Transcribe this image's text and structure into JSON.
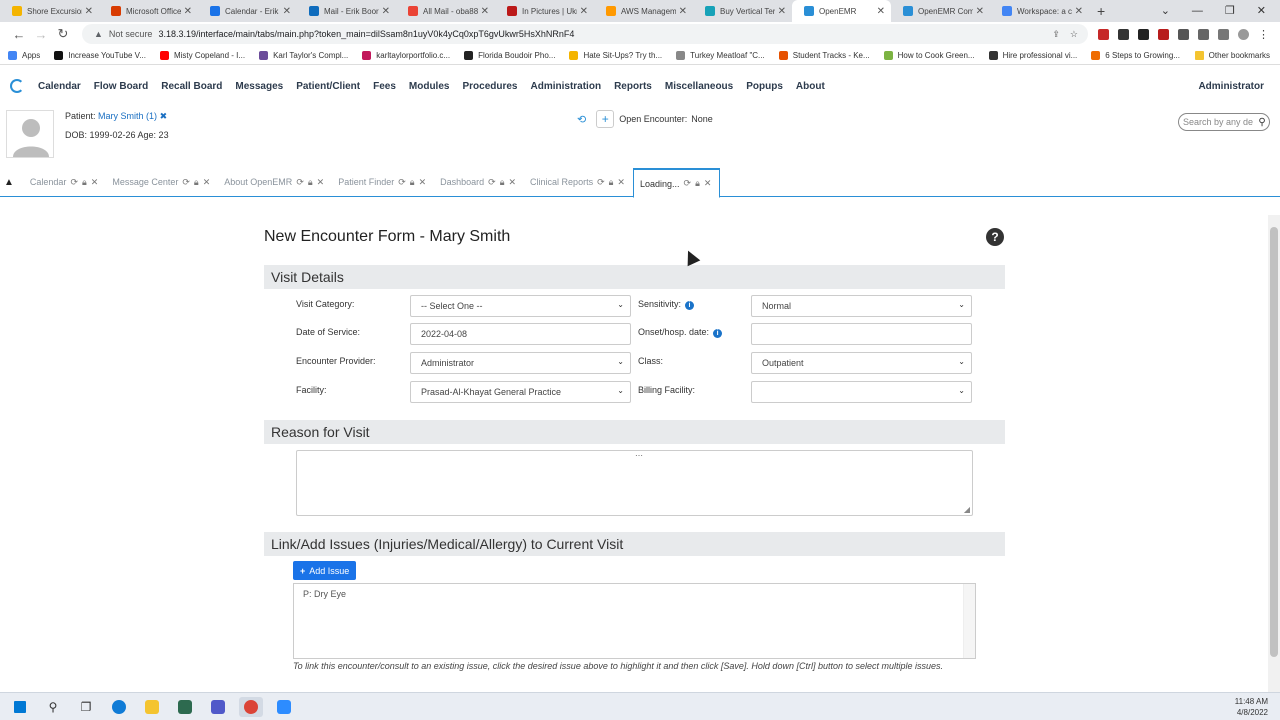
{
  "browser": {
    "tabs": [
      {
        "title": "Shore Excursion",
        "color": "#f4b400"
      },
      {
        "title": "Microsoft Office",
        "color": "#d83b01"
      },
      {
        "title": "Calendar - Erik",
        "color": "#1a73e8"
      },
      {
        "title": "Mail - Erik Boor",
        "color": "#0f6cbd"
      },
      {
        "title": "All Mail - oba88",
        "color": "#ea4335"
      },
      {
        "title": "In Pictures | Ukr",
        "color": "#bb1919"
      },
      {
        "title": "AWS Manageme",
        "color": "#ff9900"
      },
      {
        "title": "Buy Vertical Ter",
        "color": "#17a2b8"
      },
      {
        "title": "OpenEMR",
        "color": "#2a8fd6"
      },
      {
        "title": "OpenEMR Comr",
        "color": "#2a8fd6"
      },
      {
        "title": "Workspace: a co",
        "color": "#4285f4"
      }
    ],
    "active_tab_index": 8,
    "security_label": "Not secure",
    "url": "3.18.3.19/interface/main/tabs/main.php?token_main=dilSsam8n1uyV0k4yCq0xpT6gvUkwr5HsXhNRnF4",
    "bookmarks": [
      {
        "label": "Apps",
        "color": "#4285f4"
      },
      {
        "label": "Increase YouTube V...",
        "color": "#111111"
      },
      {
        "label": "Misty Copeland - I...",
        "color": "#ff0000"
      },
      {
        "label": "Karl Taylor's Compl...",
        "color": "#6b4c9a"
      },
      {
        "label": "karltaylorportfolio.c...",
        "color": "#c2185b"
      },
      {
        "label": "Florida Boudoir Pho...",
        "color": "#222222"
      },
      {
        "label": "Hate Sit-Ups? Try th...",
        "color": "#f4b400"
      },
      {
        "label": "Turkey Meatloaf \"C...",
        "color": "#888888"
      },
      {
        "label": "Student Tracks - Ke...",
        "color": "#e65100"
      },
      {
        "label": "How to Cook Green...",
        "color": "#7cb342"
      },
      {
        "label": "Hire professional vi...",
        "color": "#333333"
      },
      {
        "label": "6 Steps to Growing...",
        "color": "#ef6c00"
      }
    ],
    "other_bookmarks": "Other bookmarks"
  },
  "nav": {
    "items": [
      "Calendar",
      "Flow Board",
      "Recall Board",
      "Messages",
      "Patient/Client",
      "Fees",
      "Modules",
      "Procedures",
      "Administration",
      "Reports",
      "Miscellaneous",
      "Popups",
      "About"
    ],
    "user": "Administrator"
  },
  "patient": {
    "label": "Patient:",
    "name": "Mary Smith (1)",
    "dob_line": "DOB: 1999-02-26 Age: 23",
    "encounter_label": "Open Encounter:",
    "encounter_value": "None",
    "search_placeholder": "Search by any de"
  },
  "app_tabs": [
    {
      "label": "Calendar"
    },
    {
      "label": "Message Center"
    },
    {
      "label": "About OpenEMR"
    },
    {
      "label": "Patient Finder"
    },
    {
      "label": "Dashboard"
    },
    {
      "label": "Clinical Reports"
    },
    {
      "label": "Loading..."
    }
  ],
  "form": {
    "title": "New Encounter Form - Mary Smith",
    "visit_details": "Visit Details",
    "visit_category_label": "Visit Category:",
    "visit_category_value": "-- Select One --",
    "date_label": "Date of Service:",
    "date_value": "2022-04-08",
    "provider_label": "Encounter Provider:",
    "provider_value": "Administrator",
    "facility_label": "Facility:",
    "facility_value": "Prasad-Al-Khayat General Practice",
    "sensitivity_label": "Sensitivity:",
    "sensitivity_value": "Normal",
    "onset_label": "Onset/hosp. date:",
    "onset_value": "",
    "class_label": "Class:",
    "class_value": "Outpatient",
    "billing_label": "Billing Facility:",
    "billing_value": "",
    "reason_heading": "Reason for Visit",
    "issues_heading": "Link/Add Issues (Injuries/Medical/Allergy) to Current Visit",
    "add_issue_label": "Add Issue",
    "issues": [
      "P: Dry Eye"
    ],
    "hint": "To link this encounter/consult to an existing issue, click the desired issue above to highlight it and then click [Save]. Hold down [Ctrl] button to select multiple issues."
  },
  "taskbar": {
    "time": "11:48 AM",
    "date": "4/8/2022"
  }
}
